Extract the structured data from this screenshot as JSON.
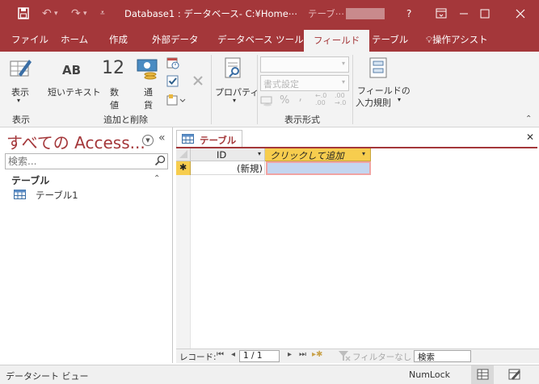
{
  "title_bar": {
    "doc_title": "Database1 : データベース- C:¥Home⋯",
    "context_tab": "テーブ⋯",
    "help": "?"
  },
  "tabs": [
    "ファイル",
    "ホーム",
    "作成",
    "外部データ",
    "データベース ツール",
    "フィールド",
    "テーブル"
  ],
  "assist": "操作アシスト",
  "ribbon": {
    "view_label": "表示",
    "short_text": "短いテキスト",
    "short_text_icon": "AB",
    "number_icon": "12",
    "number_label1": "数",
    "number_label2": "値",
    "currency_label1": "通",
    "currency_label2": "貨",
    "properties": "プロパティ",
    "format_placeholder": "書式設定",
    "percent": "%",
    "comma": "⸴",
    "dec_inc": "←.0\n.00",
    "dec_dec": ".00\n→.0",
    "field_rules1": "フィールドの",
    "field_rules2": "入力規則",
    "groups": {
      "view": "表示",
      "add_delete": "追加と削除",
      "format": "表示形式"
    }
  },
  "nav": {
    "title": "すべての Access...",
    "search_placeholder": "検索...",
    "section": "テーブル",
    "items": [
      "テーブル1"
    ]
  },
  "document": {
    "tab_label": "テーブル1",
    "columns": [
      "ID",
      "クリックして追加"
    ],
    "new_row_marker": "✱",
    "new_row_value": "(新規)"
  },
  "record_nav": {
    "label": "レコード:",
    "current": "1 / 1",
    "filter": "フィルターなし",
    "search": "検索"
  },
  "status": {
    "left": "データシート ビュー",
    "numlock": "NumLock"
  },
  "colors": {
    "accent": "#a4373a",
    "add_column_header": "#f7cd4e",
    "selected_cell": "#c4d6f0"
  }
}
